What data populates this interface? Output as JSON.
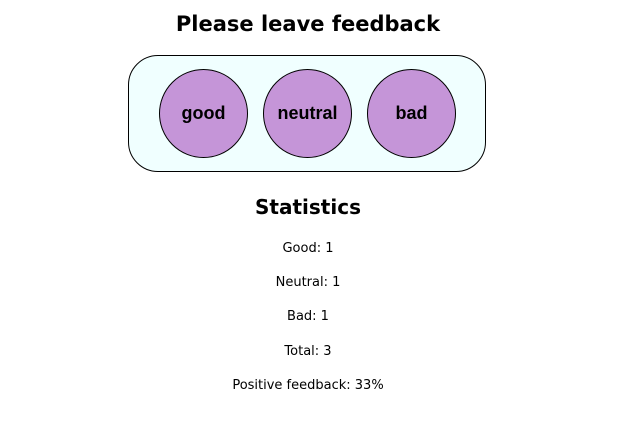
{
  "feedback": {
    "heading": "Please leave feedback",
    "buttons": {
      "good": "good",
      "neutral": "neutral",
      "bad": "bad"
    },
    "button_color": "#c595d8",
    "panel_color": "#f0ffff"
  },
  "statistics": {
    "heading": "Statistics",
    "good": "Good: 1",
    "neutral": "Neutral: 1",
    "bad": "Bad: 1",
    "total": "Total: 3",
    "positive": "Positive feedback: 33%"
  }
}
